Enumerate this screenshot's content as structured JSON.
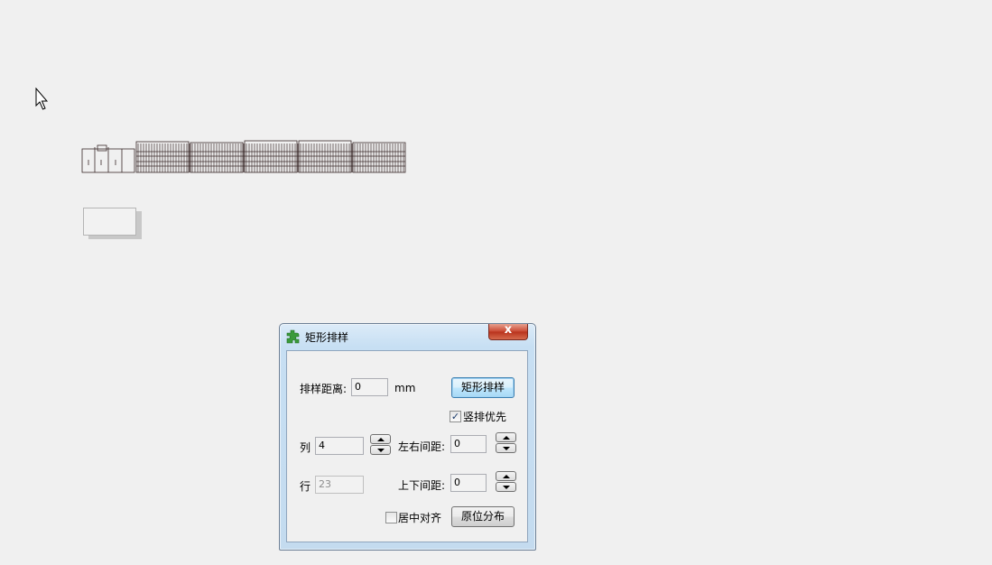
{
  "dialog": {
    "title": "矩形排样",
    "close_label": "x",
    "spacing_label": "排样距离:",
    "spacing_value": "0",
    "spacing_unit": "mm",
    "rect_nest_button": "矩形排样",
    "vertical_first_label": "竖排优先",
    "vertical_first_checked": true,
    "columns_label": "列",
    "columns_value": "4",
    "lr_gap_label": "左右间距:",
    "lr_gap_value": "0",
    "rows_label": "行",
    "rows_value": "23",
    "tb_gap_label": "上下间距:",
    "tb_gap_value": "0",
    "center_align_label": "居中对齐",
    "center_align_checked": false,
    "in_place_button": "原位分布"
  }
}
